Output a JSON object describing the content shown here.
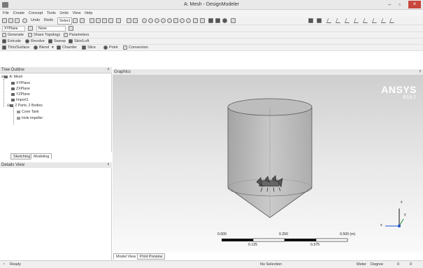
{
  "window": {
    "title": "A: Mesh - DesignModeler"
  },
  "menu": [
    "File",
    "Create",
    "Concept",
    "Tools",
    "Units",
    "View",
    "Help"
  ],
  "toolbar": {
    "undo": "Undo",
    "redo": "Redo",
    "select": "Select",
    "plane": "XYPlane",
    "sketch": "None",
    "generate": "Generate",
    "share_topology": "Share Topology",
    "parameters": "Parameters",
    "extrude": "Extrude",
    "revolve": "Revolve",
    "sweep": "Sweep",
    "skin_loft": "Skin/Loft",
    "thin_surface": "Thin/Surface",
    "blend": "Blend",
    "chamfer": "Chamfer",
    "slice": "Slice",
    "point": "Point",
    "conversion": "Conversion"
  },
  "tree": {
    "header": "Tree Outline",
    "pin": "ᵖ",
    "items": [
      "A: Mesh",
      "XYPlane",
      "ZXPlane",
      "YZPlane",
      "Import1",
      "2 Parts, 2 Bodies",
      "Cone Tank",
      "Hole impeller"
    ]
  },
  "left_tabs": [
    "Sketching",
    "Modeling"
  ],
  "details": {
    "header": "Details View",
    "pin": "ᵖ"
  },
  "graphics": {
    "header": "Graphics",
    "brand": "ANSYS",
    "version": "R19.2",
    "scale_top": [
      "0.000",
      "0.250",
      "0.500 (m)"
    ],
    "scale_bottom": [
      "0.125",
      "0.375"
    ],
    "axes": {
      "x": "x",
      "y": "y",
      "z": "z"
    }
  },
  "bottom_tabs": [
    "Model View",
    "Print Preview"
  ],
  "status": {
    "ready": "Ready",
    "selection": "No Selection",
    "units": "Meter",
    "angle": "Degree",
    "zero1": "0",
    "zero2": "0"
  }
}
